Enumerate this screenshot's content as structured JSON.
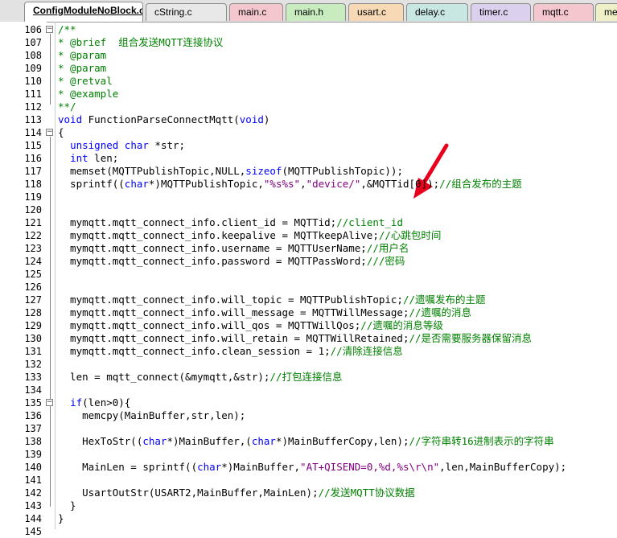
{
  "tabs": [
    {
      "label": "ConfigModuleNoBlock.c",
      "active": true,
      "color": "#ffffff"
    },
    {
      "label": "cString.c",
      "active": false,
      "color": "#e8e8e8"
    },
    {
      "label": "main.c",
      "active": false,
      "color": "#f4c7cf"
    },
    {
      "label": "main.h",
      "active": false,
      "color": "#c8ecc0"
    },
    {
      "label": "usart.c",
      "active": false,
      "color": "#f7d9b5"
    },
    {
      "label": "delay.c",
      "active": false,
      "color": "#c8e6e2"
    },
    {
      "label": "timer.c",
      "active": false,
      "color": "#dcd0ef"
    },
    {
      "label": "mqtt.c",
      "active": false,
      "color": "#f4c7cf"
    },
    {
      "label": "me",
      "active": false,
      "color": "#f0f0c8"
    }
  ],
  "colors": {
    "comment": "#008000",
    "keyword": "#0000ff",
    "string": "#800080",
    "arrow": "#e8001c"
  },
  "icons": {
    "fold_open": "minus-box-icon",
    "annotation": "red-arrow-icon"
  },
  "lines": [
    {
      "n": "106",
      "fold": "-",
      "seg": [
        [
          "c",
          "/**"
        ]
      ]
    },
    {
      "n": "107",
      "seg": [
        [
          "c",
          "* @brief  组合发送MQTT连接协议"
        ]
      ]
    },
    {
      "n": "108",
      "seg": [
        [
          "c",
          "* @param"
        ]
      ]
    },
    {
      "n": "109",
      "seg": [
        [
          "c",
          "* @param"
        ]
      ]
    },
    {
      "n": "110",
      "seg": [
        [
          "c",
          "* @retval"
        ]
      ]
    },
    {
      "n": "111",
      "seg": [
        [
          "c",
          "* @example"
        ]
      ]
    },
    {
      "n": "112",
      "seg": [
        [
          "c",
          "**/"
        ]
      ]
    },
    {
      "n": "113",
      "seg": [
        [
          "k",
          "void"
        ],
        [
          "t",
          " FunctionParseConnectMqtt("
        ],
        [
          "k",
          "void"
        ],
        [
          "t",
          ")"
        ]
      ]
    },
    {
      "n": "114",
      "fold": "-",
      "seg": [
        [
          "t",
          "{"
        ]
      ]
    },
    {
      "n": "115",
      "seg": [
        [
          "t",
          "  "
        ],
        [
          "k",
          "unsigned char"
        ],
        [
          "t",
          " *str;"
        ]
      ]
    },
    {
      "n": "116",
      "seg": [
        [
          "t",
          "  "
        ],
        [
          "k",
          "int"
        ],
        [
          "t",
          " len;"
        ]
      ]
    },
    {
      "n": "117",
      "seg": [
        [
          "t",
          "  memset(MQTTPublishTopic,NULL,"
        ],
        [
          "k",
          "sizeof"
        ],
        [
          "t",
          "(MQTTPublishTopic));"
        ]
      ]
    },
    {
      "n": "118",
      "seg": [
        [
          "t",
          "  sprintf(("
        ],
        [
          "k",
          "char"
        ],
        [
          "t",
          "*)MQTTPublishTopic,"
        ],
        [
          "s",
          "\"%s%s\""
        ],
        [
          "t",
          ","
        ],
        [
          "s",
          "\"device/\""
        ],
        [
          "t",
          ",&MQTTid[0]);"
        ],
        [
          "c",
          "//组合发布的主题"
        ]
      ]
    },
    {
      "n": "119",
      "seg": []
    },
    {
      "n": "120",
      "seg": []
    },
    {
      "n": "121",
      "seg": [
        [
          "t",
          "  mymqtt.mqtt_connect_info.client_id = MQTTid;"
        ],
        [
          "c",
          "//client_id"
        ]
      ]
    },
    {
      "n": "122",
      "seg": [
        [
          "t",
          "  mymqtt.mqtt_connect_info.keepalive = MQTTkeepAlive;"
        ],
        [
          "c",
          "//心跳包时间"
        ]
      ]
    },
    {
      "n": "123",
      "seg": [
        [
          "t",
          "  mymqtt.mqtt_connect_info.username = MQTTUserName;"
        ],
        [
          "c",
          "//用户名"
        ]
      ]
    },
    {
      "n": "124",
      "seg": [
        [
          "t",
          "  mymqtt.mqtt_connect_info.password = MQTTPassWord;"
        ],
        [
          "c",
          "///密码"
        ]
      ]
    },
    {
      "n": "125",
      "seg": []
    },
    {
      "n": "126",
      "seg": []
    },
    {
      "n": "127",
      "seg": [
        [
          "t",
          "  mymqtt.mqtt_connect_info.will_topic = MQTTPublishTopic;"
        ],
        [
          "c",
          "//遗嘱发布的主题"
        ]
      ]
    },
    {
      "n": "128",
      "seg": [
        [
          "t",
          "  mymqtt.mqtt_connect_info.will_message = MQTTWillMessage;"
        ],
        [
          "c",
          "//遗嘱的消息"
        ]
      ]
    },
    {
      "n": "129",
      "seg": [
        [
          "t",
          "  mymqtt.mqtt_connect_info.will_qos = MQTTWillQos;"
        ],
        [
          "c",
          "//遗嘱的消息等级"
        ]
      ]
    },
    {
      "n": "130",
      "seg": [
        [
          "t",
          "  mymqtt.mqtt_connect_info.will_retain = MQTTWillRetained;"
        ],
        [
          "c",
          "//是否需要服务器保留消息"
        ]
      ]
    },
    {
      "n": "131",
      "seg": [
        [
          "t",
          "  mymqtt.mqtt_connect_info.clean_session = 1;"
        ],
        [
          "c",
          "//清除连接信息"
        ]
      ]
    },
    {
      "n": "132",
      "seg": []
    },
    {
      "n": "133",
      "seg": [
        [
          "t",
          "  len = mqtt_connect(&mymqtt,&str);"
        ],
        [
          "c",
          "//打包连接信息"
        ]
      ]
    },
    {
      "n": "134",
      "seg": []
    },
    {
      "n": "135",
      "fold": "-",
      "seg": [
        [
          "t",
          "  "
        ],
        [
          "k",
          "if"
        ],
        [
          "t",
          "(len>0){"
        ]
      ]
    },
    {
      "n": "136",
      "seg": [
        [
          "t",
          "    memcpy(MainBuffer,str,len);"
        ]
      ]
    },
    {
      "n": "137",
      "seg": []
    },
    {
      "n": "138",
      "seg": [
        [
          "t",
          "    HexToStr(("
        ],
        [
          "k",
          "char"
        ],
        [
          "t",
          "*)MainBuffer,("
        ],
        [
          "k",
          "char"
        ],
        [
          "t",
          "*)MainBufferCopy,len);"
        ],
        [
          "c",
          "//字符串转16进制表示的字符串"
        ]
      ]
    },
    {
      "n": "139",
      "seg": []
    },
    {
      "n": "140",
      "seg": [
        [
          "t",
          "    MainLen = sprintf(("
        ],
        [
          "k",
          "char"
        ],
        [
          "t",
          "*)MainBuffer,"
        ],
        [
          "s",
          "\"AT+QISEND=0,%d,%s\\r\\n\""
        ],
        [
          "t",
          ",len,MainBufferCopy);"
        ]
      ]
    },
    {
      "n": "141",
      "seg": []
    },
    {
      "n": "142",
      "seg": [
        [
          "t",
          "    UsartOutStr(USART2,MainBuffer,MainLen);"
        ],
        [
          "c",
          "//发送MQTT协议数据"
        ]
      ]
    },
    {
      "n": "143",
      "seg": [
        [
          "t",
          "  }"
        ]
      ]
    },
    {
      "n": "144",
      "seg": [
        [
          "t",
          "}"
        ]
      ]
    },
    {
      "n": "145",
      "seg": []
    }
  ]
}
